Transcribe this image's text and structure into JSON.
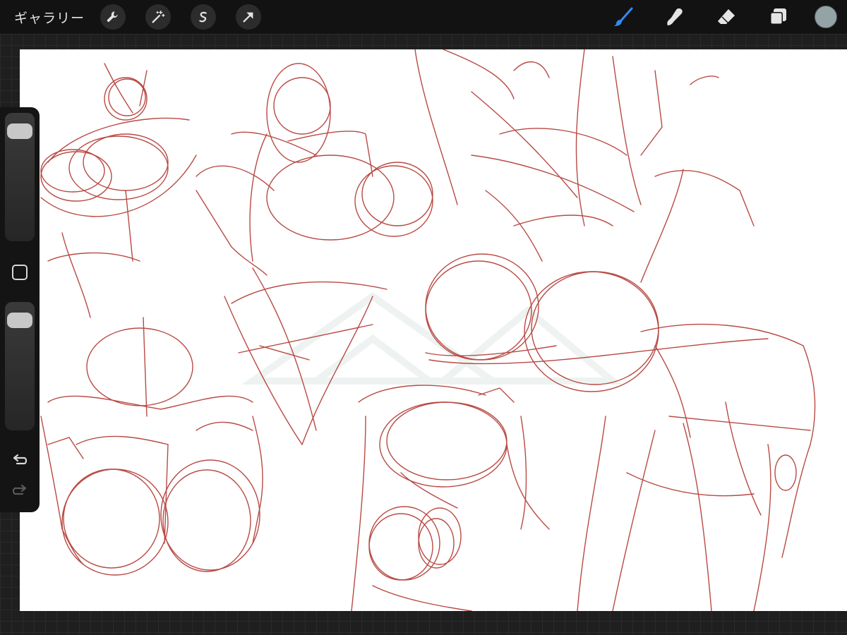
{
  "topbar": {
    "gallery_label": "ギャラリー",
    "left_tools": [
      {
        "name": "actions",
        "icon": "wrench-icon"
      },
      {
        "name": "adjustments",
        "icon": "magic-wand-icon"
      },
      {
        "name": "selection",
        "icon": "selection-s-icon"
      },
      {
        "name": "transform",
        "icon": "arrow-cursor-icon"
      }
    ],
    "right_tools": [
      {
        "name": "brush",
        "icon": "brush-icon",
        "active": true,
        "color": "#2f8bf4"
      },
      {
        "name": "smudge",
        "icon": "smudge-finger-icon"
      },
      {
        "name": "eraser",
        "icon": "eraser-icon"
      },
      {
        "name": "layers",
        "icon": "layers-icon"
      }
    ],
    "current_color": "#93a3a6"
  },
  "sidebar": {
    "brush_size_slider": {
      "icon": "slider-handle",
      "value": 0.95
    },
    "modifier_icon": "square-icon",
    "opacity_slider": {
      "icon": "slider-handle",
      "value": 0.95
    },
    "undo_icon": "undo-icon",
    "redo_icon": "redo-icon"
  },
  "canvas": {
    "background": "#ffffff",
    "stroke_color": "#b84a44",
    "watermark_color": "#eef3f2"
  }
}
